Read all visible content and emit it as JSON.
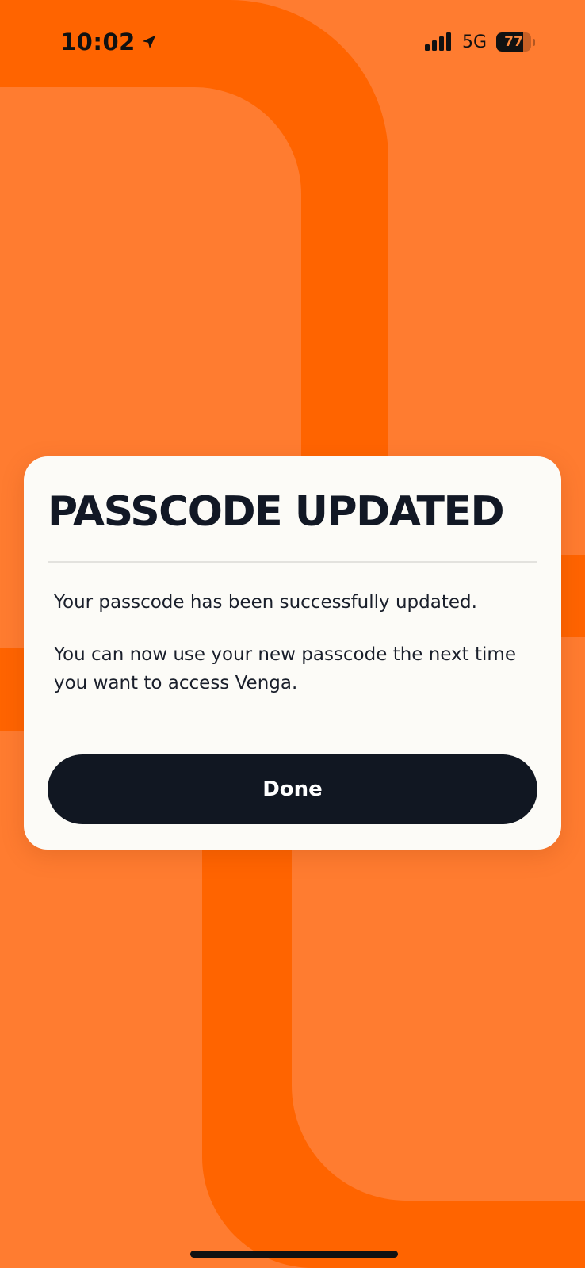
{
  "status_bar": {
    "time": "10:02",
    "network": "5G",
    "battery_level": "77",
    "battery_fraction": 0.77,
    "location_icon": "location-arrow-icon",
    "signal_icon": "cellular-signal-icon"
  },
  "modal": {
    "title": "PASSCODE UPDATED",
    "message_1": "Your passcode has been successfully updated.",
    "message_2": "You can now use your new passcode the next time you want to access Venga.",
    "done_label": "Done"
  },
  "colors": {
    "background": "#FF7C30",
    "accent_stripe": "#FF6400",
    "card": "#FCFBF7",
    "button": "#111722",
    "title_text": "#121825"
  }
}
